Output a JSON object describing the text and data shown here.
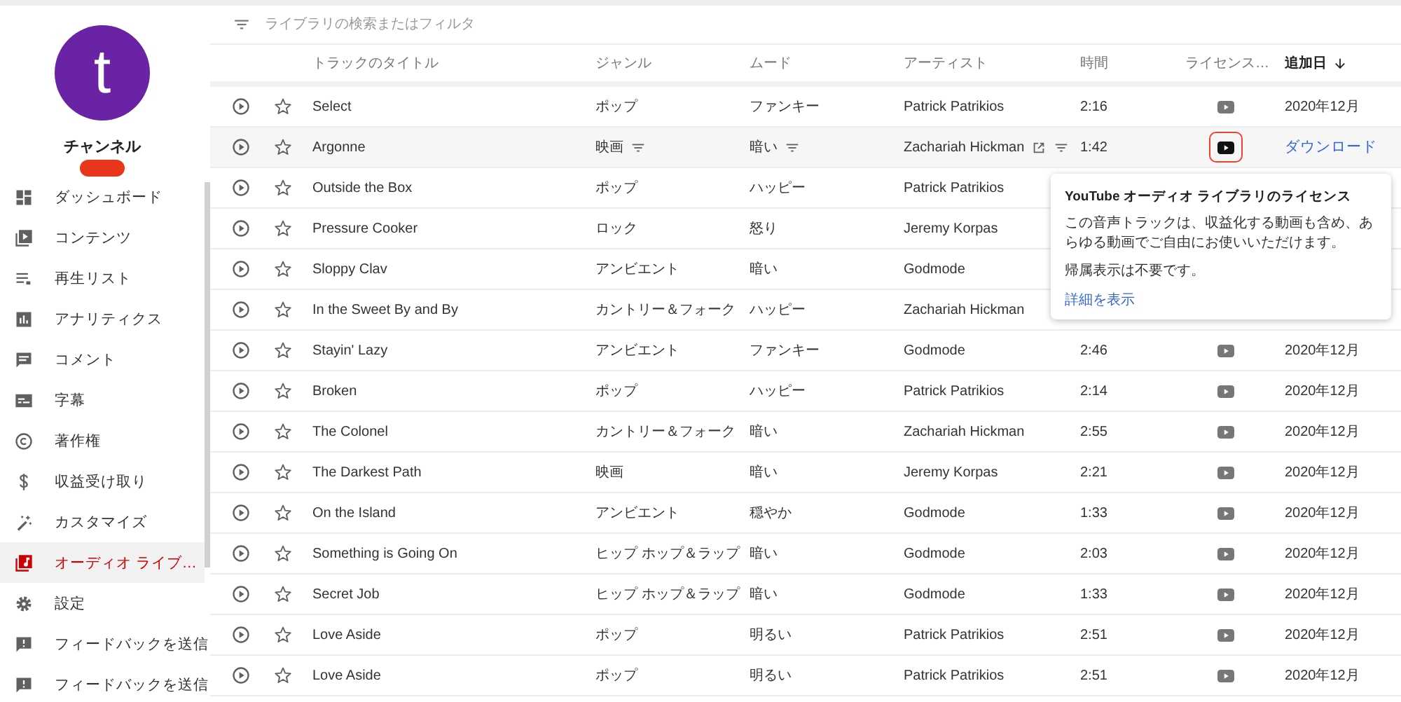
{
  "channel": {
    "avatar_letter": "t",
    "name": "チャンネル"
  },
  "sidebar": {
    "items": [
      {
        "label": "ダッシュボード",
        "selected": false
      },
      {
        "label": "コンテンツ",
        "selected": false
      },
      {
        "label": "再生リスト",
        "selected": false
      },
      {
        "label": "アナリティクス",
        "selected": false
      },
      {
        "label": "コメント",
        "selected": false
      },
      {
        "label": "字幕",
        "selected": false
      },
      {
        "label": "著作権",
        "selected": false
      },
      {
        "label": "収益受け取り",
        "selected": false
      },
      {
        "label": "カスタマイズ",
        "selected": false
      },
      {
        "label": "オーディオ ライブ…",
        "selected": true
      },
      {
        "label": "設定",
        "selected": false
      },
      {
        "label": "フィードバックを送信",
        "selected": false
      },
      {
        "label": "フィードバックを送信",
        "selected": false
      }
    ]
  },
  "search": {
    "placeholder": "ライブラリの検索またはフィルタ"
  },
  "table": {
    "columns": [
      "トラックのタイトル",
      "ジャンル",
      "ムード",
      "アーティスト",
      "時間",
      "ライセンス…",
      "追加日"
    ],
    "rows": [
      {
        "title": "Select",
        "genre": "ポップ",
        "mood": "ファンキー",
        "artist": "Patrick Patrikios",
        "time": "2:16",
        "license": true,
        "added": "2020年12月",
        "hovered": false
      },
      {
        "title": "Argonne",
        "genre": "映画",
        "mood": "暗い",
        "artist": "Zachariah Hickman",
        "time": "1:42",
        "license": true,
        "download": "ダウンロード",
        "hovered": true
      },
      {
        "title": "Outside the Box",
        "genre": "ポップ",
        "mood": "ハッピー",
        "artist": "Patrick Patrikios",
        "hovered": false
      },
      {
        "title": "Pressure Cooker",
        "genre": "ロック",
        "mood": "怒り",
        "artist": "Jeremy Korpas",
        "hovered": false
      },
      {
        "title": "Sloppy Clav",
        "genre": "アンビエント",
        "mood": "暗い",
        "artist": "Godmode",
        "hovered": false
      },
      {
        "title": "In the Sweet By and By",
        "genre": "カントリー＆フォーク",
        "mood": "ハッピー",
        "artist": "Zachariah Hickman",
        "hovered": false
      },
      {
        "title": "Stayin' Lazy",
        "genre": "アンビエント",
        "mood": "ファンキー",
        "artist": "Godmode",
        "time": "2:46",
        "license": true,
        "added": "2020年12月",
        "hovered": false
      },
      {
        "title": "Broken",
        "genre": "ポップ",
        "mood": "ハッピー",
        "artist": "Patrick Patrikios",
        "time": "2:14",
        "license": true,
        "added": "2020年12月",
        "hovered": false
      },
      {
        "title": "The Colonel",
        "genre": "カントリー＆フォーク",
        "mood": "暗い",
        "artist": "Zachariah Hickman",
        "time": "2:55",
        "license": true,
        "added": "2020年12月",
        "hovered": false
      },
      {
        "title": "The Darkest Path",
        "genre": "映画",
        "mood": "暗い",
        "artist": "Jeremy Korpas",
        "time": "2:21",
        "license": true,
        "added": "2020年12月",
        "hovered": false
      },
      {
        "title": "On the Island",
        "genre": "アンビエント",
        "mood": "穏やか",
        "artist": "Godmode",
        "time": "1:33",
        "license": true,
        "added": "2020年12月",
        "hovered": false
      },
      {
        "title": "Something is Going On",
        "genre": "ヒップ ホップ＆ラップ",
        "mood": "暗い",
        "artist": "Godmode",
        "time": "2:03",
        "license": true,
        "added": "2020年12月",
        "hovered": false
      },
      {
        "title": "Secret Job",
        "genre": "ヒップ ホップ＆ラップ",
        "mood": "暗い",
        "artist": "Godmode",
        "time": "1:33",
        "license": true,
        "added": "2020年12月",
        "hovered": false
      },
      {
        "title": "Love Aside",
        "genre": "ポップ",
        "mood": "明るい",
        "artist": "Patrick Patrikios",
        "time": "2:51",
        "license": true,
        "added": "2020年12月",
        "hovered": false
      },
      {
        "title": "Love Aside",
        "genre": "ポップ",
        "mood": "明るい",
        "artist": "Patrick Patrikios",
        "time": "2:51",
        "license": true,
        "added": "2020年12月",
        "hovered": false
      }
    ]
  },
  "popover": {
    "title": "YouTube オーディオ ライブラリのライセンス",
    "body": "この音声トラックは、収益化する動画も含め、あらゆる動画でご自由にお使いいただけます。",
    "note": "帰属表示は不要です。",
    "link": "詳細を表示"
  }
}
